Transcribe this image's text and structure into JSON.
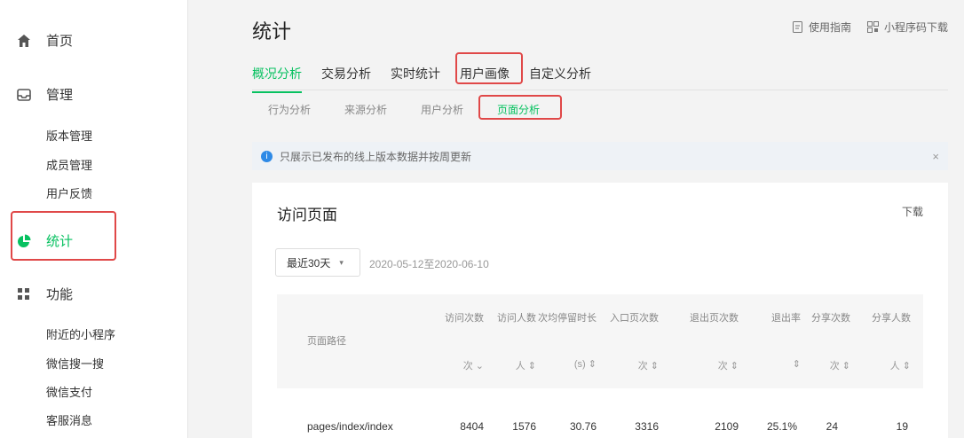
{
  "sidebar": {
    "home": "首页",
    "manage": "管理",
    "manage_items": [
      "版本管理",
      "成员管理",
      "用户反馈"
    ],
    "stats": "统计",
    "features": "功能",
    "features_items": [
      "附近的小程序",
      "微信搜一搜",
      "微信支付",
      "客服消息"
    ]
  },
  "header": {
    "title": "统计",
    "links": [
      "使用指南",
      "小程序码下载"
    ]
  },
  "tabs": [
    "概况分析",
    "交易分析",
    "实时统计",
    "用户画像",
    "自定义分析"
  ],
  "subtabs": [
    "行为分析",
    "来源分析",
    "用户分析",
    "页面分析"
  ],
  "notice": {
    "text": "只展示已发布的线上版本数据并按周更新",
    "close": "×"
  },
  "card": {
    "title": "访问页面",
    "download": "下载",
    "range": "最近30天",
    "date_range": "2020-05-12至2020-06-10"
  },
  "table": {
    "path_header": "页面路径",
    "columns": [
      "访问次数",
      "访问人数",
      "次均停留时长",
      "入口页次数",
      "退出页次数",
      "退出率",
      "分享次数",
      "分享人数"
    ],
    "sort_labels": [
      "次 ⌄",
      "人 ⇕",
      "(s) ⇕",
      "次 ⇕",
      "次 ⇕",
      "⇕",
      "次 ⇕",
      "人 ⇕"
    ],
    "row": [
      "pages/index/index",
      "8404",
      "1576",
      "30.76",
      "3316",
      "2109",
      "25.1%",
      "24",
      "19"
    ]
  },
  "colors": {
    "accent": "#07c160",
    "highlight": "#e04848",
    "info": "#2e8ae6"
  }
}
